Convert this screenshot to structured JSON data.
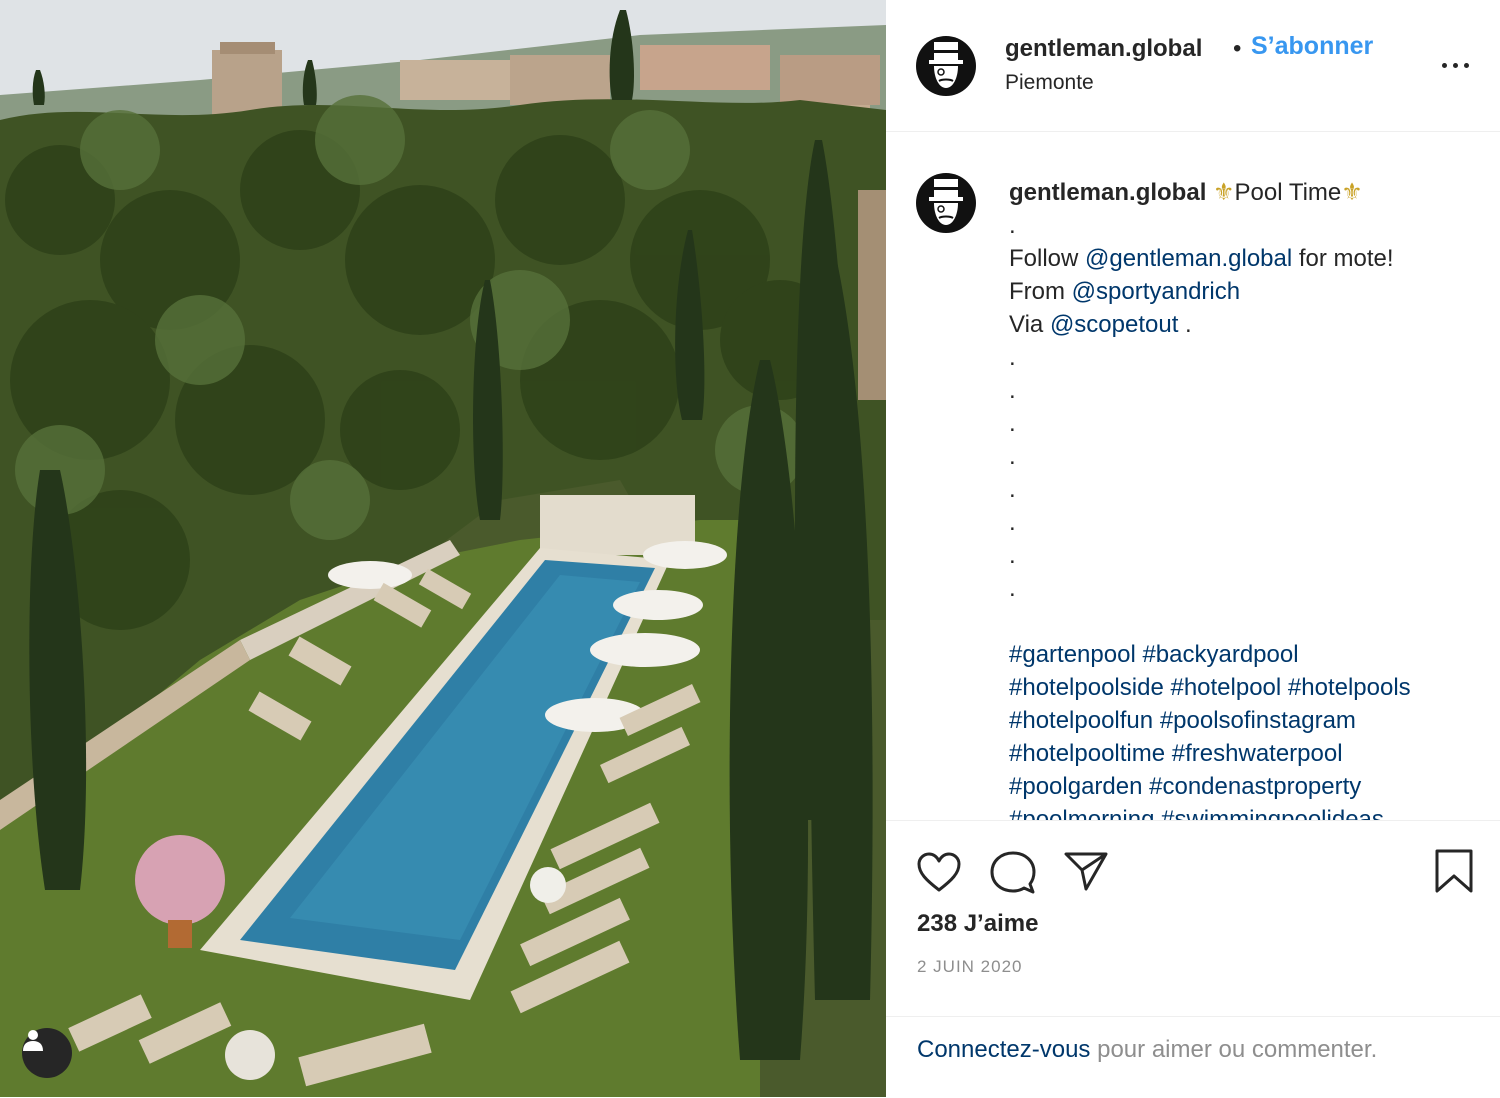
{
  "post": {
    "username": "gentleman.global",
    "separator": "•",
    "follow_label": "S’abonner",
    "location": "Piemonte",
    "more_label": "More options"
  },
  "caption": {
    "username": "gentleman.global",
    "fleur": "⚜",
    "title": "Pool Time",
    "dot": ".",
    "follow_prefix": "Follow",
    "follow_mention": "@gentleman.global",
    "follow_suffix": "for mote!",
    "from_prefix": "From",
    "from_mention": "@sportyandrich",
    "via_prefix": "Via",
    "via_mention": "@scopetout",
    "via_suffix": ".",
    "hashtag_lines": [
      [
        "#gartenpool",
        "#backyardpool"
      ],
      [
        "#hotelpoolside",
        "#hotelpool",
        "#hotelpools"
      ],
      [
        "#hotelpoolfun",
        "#poolsofinstagram"
      ],
      [
        "#hotelpooltime",
        "#freshwaterpool"
      ],
      [
        "#poolgarden",
        "#condenastproperty"
      ],
      [
        "#poolmorning",
        "#swimmingpoolideas"
      ]
    ]
  },
  "actions": {
    "likes": "238 J’aime",
    "date": "2 JUIN 2020"
  },
  "footer": {
    "login_link": "Connectez-vous",
    "login_rest": "pour aimer ou commenter."
  },
  "colors": {
    "link": "#00376b",
    "follow": "#3897f0",
    "muted": "#8e8e8e",
    "text": "#262626"
  }
}
